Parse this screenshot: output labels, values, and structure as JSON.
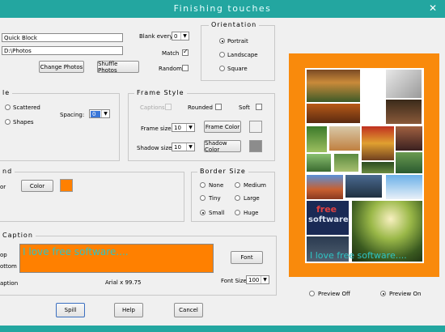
{
  "window": {
    "title": "Finishing touches",
    "close": "✕"
  },
  "source": {
    "name_value": "Quick Block",
    "path_value": "D:\\Photos",
    "change_photos": "Change Photos",
    "shuffle_photos": "Shuffle Photos",
    "blank_every_label": "Blank every:",
    "blank_every_value": "0",
    "match_label": "Match",
    "match_checked": true,
    "random_label": "Random",
    "random_checked": false
  },
  "orientation": {
    "title": "Orientation",
    "options": [
      "Portrait",
      "Landscape",
      "Square"
    ],
    "selected": "Portrait"
  },
  "layout_style": {
    "title_fragment": "le",
    "options": [
      "Scattered",
      "Shapes"
    ],
    "spacing_label": "Spacing:",
    "spacing_value": "0"
  },
  "frame_style": {
    "title": "Frame Style",
    "captions_label": "Captions",
    "rounded_label": "Rounded",
    "soft_label": "Soft",
    "frame_size_label": "Frame size:",
    "frame_size_value": "10",
    "frame_color_button": "Frame Color",
    "frame_color": "#f0f0f0",
    "shadow_size_label": "Shadow size:",
    "shadow_size_value": "10",
    "shadow_color_button": "Shadow Color",
    "shadow_color": "#8c8c8c"
  },
  "background": {
    "title_fragment": "nd",
    "color_label_fragment": "or",
    "color_button": "Color",
    "color": "#ff8000"
  },
  "border_size": {
    "title": "Border Size",
    "options": [
      "None",
      "Medium",
      "Tiny",
      "Large",
      "Small",
      "Huge"
    ],
    "selected": "Small"
  },
  "caption": {
    "title_fragment": "Caption",
    "top_fragment": "op",
    "bottom_fragment": "ottom",
    "caption_fragment": "aption",
    "text": "I love free software....",
    "text_color": "#2ec4c4",
    "box_color": "#ff8000",
    "font_button": "Font",
    "font_info": "Arial  x  99.75",
    "font_size_label": "Font Size:",
    "font_size_value": "100"
  },
  "preview": {
    "border_color": "#f98a0c",
    "caption_overlay": "I love free software....",
    "logo_text_1": "free",
    "logo_text_2": "software",
    "off_label": "Preview Off",
    "on_label": "Preview On",
    "selected": "Preview On"
  },
  "actions": {
    "spill": "Spill",
    "help": "Help",
    "cancel": "Cancel"
  }
}
